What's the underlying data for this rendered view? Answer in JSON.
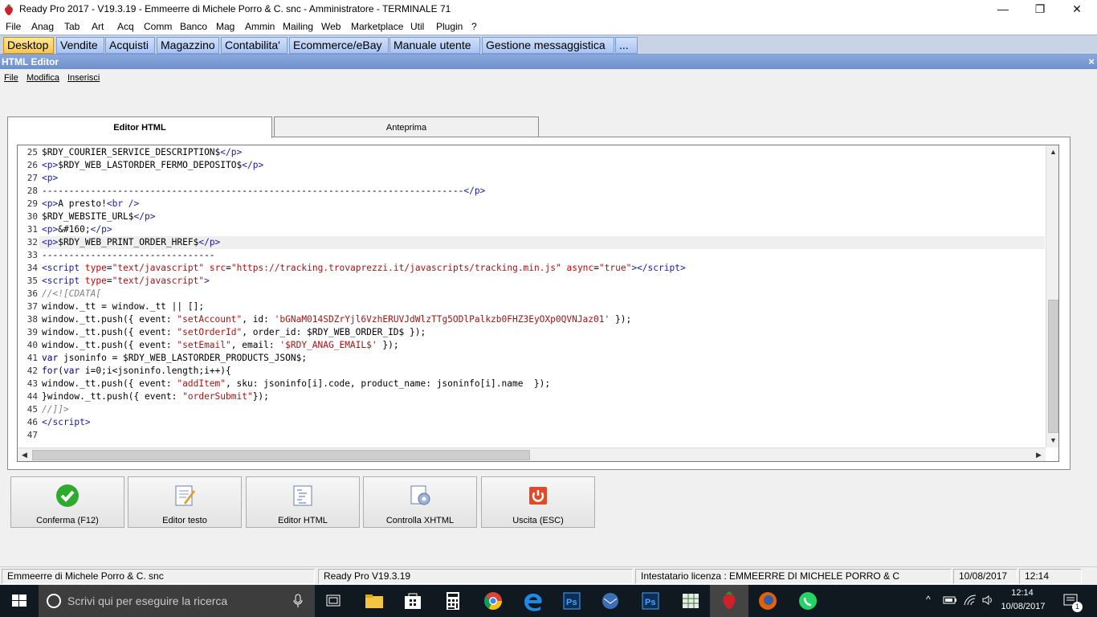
{
  "window": {
    "title": "Ready Pro 2017 - V19.3.19 - Emmeerre di Michele Porro & C. snc - Amministratore - TERMINALE 71"
  },
  "menubar": [
    "File",
    "Anag",
    "Tab",
    "Art",
    "Acq",
    "Comm",
    "Banco",
    "Mag",
    "Ammin",
    "Mailing",
    "Web",
    "Marketplace",
    "Util",
    "Plugin",
    "?"
  ],
  "navtabs": [
    "Desktop",
    "Vendite",
    "Acquisti",
    "Magazzino",
    "Contabilita'",
    "Ecommerce/eBay",
    "Manuale utente",
    "Gestione messaggistica",
    "..."
  ],
  "editor": {
    "title": "HTML Editor",
    "close": "×",
    "menu": [
      "File",
      "Modifica",
      "Inserisci"
    ]
  },
  "panel_tabs": [
    "Editor HTML",
    "Anteprima"
  ],
  "code_lines": [
    {
      "n": "25",
      "html": "$RDY_COURIER_SERVICE_DESCRIPTION$<span class='tag'>&lt;/p&gt;</span>"
    },
    {
      "n": "26",
      "html": "<span class='tag'>&lt;p&gt;</span>$RDY_WEB_LASTORDER_FERMO_DEPOSITO$<span class='tag'>&lt;/p&gt;</span>"
    },
    {
      "n": "27",
      "html": "<span class='tag'>&lt;p&gt;</span>"
    },
    {
      "n": "28",
      "html": "------------------------------------------------------------------------------<span class='tag'>&lt;/p&gt;</span>"
    },
    {
      "n": "29",
      "html": "<span class='tag'>&lt;p&gt;</span>A presto!<span class='tag'>&lt;br /&gt;</span>"
    },
    {
      "n": "30",
      "html": "$RDY_WEBSITE_URL$<span class='tag'>&lt;/p&gt;</span>"
    },
    {
      "n": "31",
      "html": "<span class='tag'>&lt;p&gt;</span>&amp;#160;<span class='tag'>&lt;/p&gt;</span>"
    },
    {
      "n": "32",
      "html": "<span class='tag'>&lt;p&gt;</span>$RDY_WEB_PRINT_ORDER_HREF$<span class='tag'>&lt;/p&gt;</span>"
    },
    {
      "n": "33",
      "html": "--------------------------------"
    },
    {
      "n": "34",
      "html": "<span class='tag'>&lt;script</span> <span class='attr'>type</span>=<span class='str'>\"text/javascript\"</span> <span class='attr'>src</span>=<span class='str'>\"https://tracking.trovaprezzi.it/javascripts/tracking.min.js\"</span> <span class='attr'>async</span>=<span class='str'>\"true\"</span><span class='tag'>&gt;&lt;/script&gt;</span>"
    },
    {
      "n": "35",
      "html": "<span class='tag'>&lt;script</span> <span class='attr'>type</span>=<span class='str'>\"text/javascript\"</span><span class='tag'>&gt;</span>"
    },
    {
      "n": "36",
      "html": "<span class='cmt'>//&lt;![CDATA[</span>"
    },
    {
      "n": "37",
      "html": "window._tt = window._tt || [];"
    },
    {
      "n": "38",
      "html": "window._tt.push({ event: <span class='str'>\"setAccount\"</span>, id: <span class='str'>'bGNaM014SDZrYjl6VzhERUVJdWlzTTg5ODlPalkzb0FHZ3EyOXp0QVNJaz01'</span> });"
    },
    {
      "n": "39",
      "html": "window._tt.push({ event: <span class='str'>\"setOrderId\"</span>, order_id: $RDY_WEB_ORDER_ID$ });"
    },
    {
      "n": "40",
      "html": "window._tt.push({ event: <span class='str'>\"setEmail\"</span>, email: <span class='str'>'$RDY_ANAG_EMAIL$'</span> });"
    },
    {
      "n": "41",
      "html": "<span class='kw'>var</span> jsoninfo = $RDY_WEB_LASTORDER_PRODUCTS_JSON$;"
    },
    {
      "n": "42",
      "html": "<span class='kw'>for</span>(<span class='kw'>var</span> i=0;i&lt;jsoninfo.length;i++){"
    },
    {
      "n": "43",
      "html": "window._tt.push({ event: <span class='str'>\"addItem\"</span>, sku: jsoninfo[i].code, product_name: jsoninfo[i].name  });"
    },
    {
      "n": "44",
      "html": "}window._tt.push({ event: <span class='str'>\"orderSubmit\"</span>});"
    },
    {
      "n": "45",
      "html": "<span class='cmt'>//]]&gt;</span>"
    },
    {
      "n": "46",
      "html": "<span class='tag'>&lt;/script&gt;</span>"
    },
    {
      "n": "47",
      "html": ""
    }
  ],
  "buttons": [
    {
      "label": "Conferma (F12)",
      "icon": "check-icon"
    },
    {
      "label": "Editor testo",
      "icon": "text-editor-icon"
    },
    {
      "label": "Editor HTML",
      "icon": "html-editor-icon"
    },
    {
      "label": "Controlla XHTML",
      "icon": "check-xhtml-icon"
    },
    {
      "label": "Uscita (ESC)",
      "icon": "power-icon"
    }
  ],
  "status": {
    "company": "Emmeerre di Michele Porro & C. snc",
    "version": "Ready Pro V19.3.19",
    "license": "Intestatario licenza : EMMEERRE DI MICHELE PORRO & C",
    "date": "10/08/2017",
    "time": "12:14"
  },
  "taskbar": {
    "search_placeholder": "Scrivi qui per eseguire la ricerca",
    "clock_time": "12:14",
    "clock_date": "10/08/2017",
    "notif_count": "1"
  }
}
